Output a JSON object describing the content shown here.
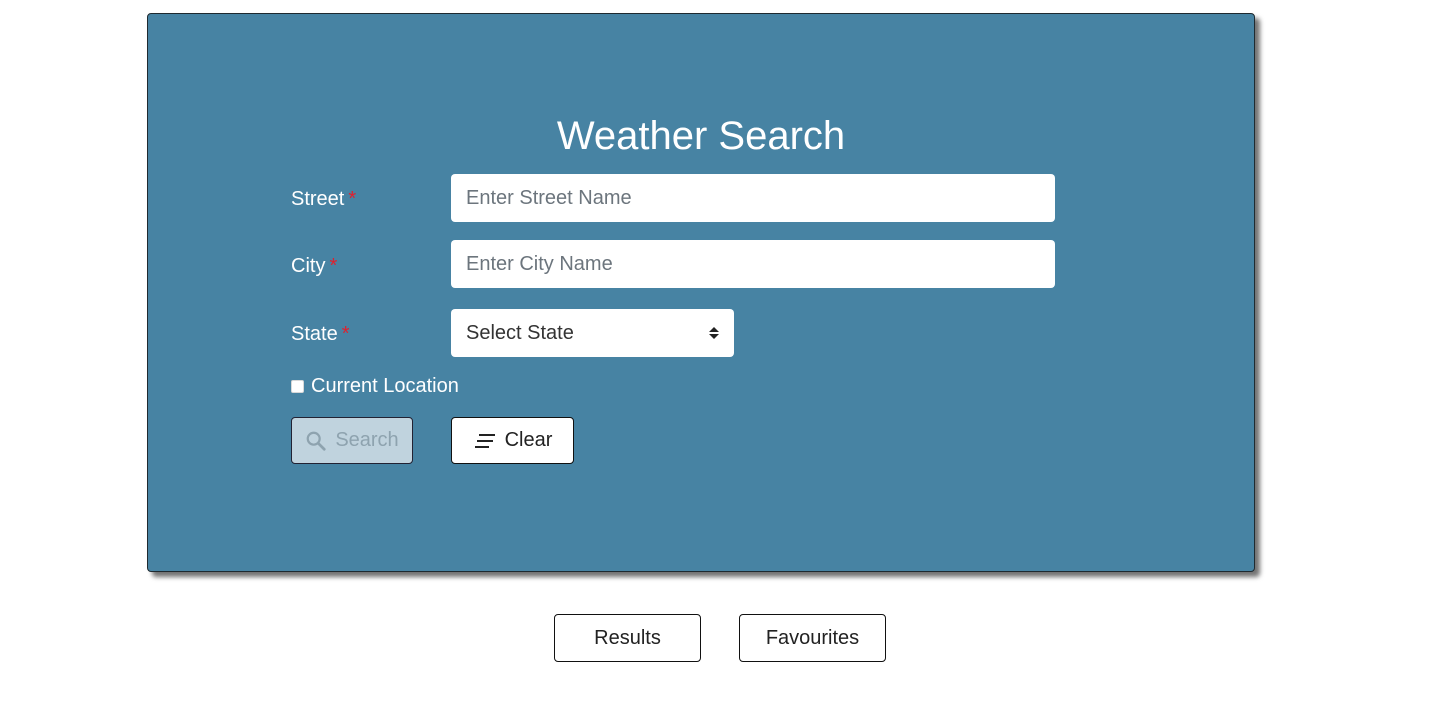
{
  "form": {
    "title": "Weather Search",
    "street": {
      "label": "Street",
      "required_mark": "*",
      "placeholder": "Enter Street Name",
      "value": ""
    },
    "city": {
      "label": "City",
      "required_mark": "*",
      "placeholder": "Enter City Name",
      "value": ""
    },
    "state": {
      "label": "State",
      "required_mark": "*",
      "selected": "Select State"
    },
    "current_location": {
      "label": "Current Location",
      "checked": false
    },
    "buttons": {
      "search_label": "Search",
      "search_icon": "search-icon",
      "clear_label": "Clear",
      "clear_icon": "clear-lines-icon"
    }
  },
  "nav": {
    "results_label": "Results",
    "favourites_label": "Favourites"
  },
  "colors": {
    "panel_bg": "#4783a3",
    "required": "#e0202e",
    "search_disabled_bg": "#c0d3de"
  }
}
